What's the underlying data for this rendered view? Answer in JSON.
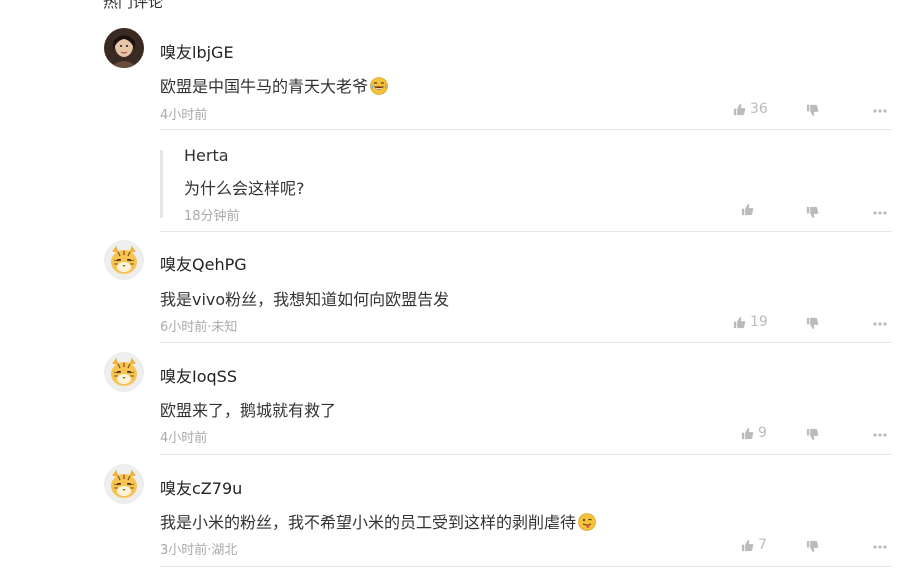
{
  "top_cut_text": "热门评论",
  "thread": {
    "comments": [
      {
        "username": "嗅友lbjGE",
        "content": "欧盟是中国牛马的青天大老爷",
        "emoji_icon": "laughing-emoji-icon",
        "meta": "4小时前",
        "likes": "36",
        "avatar": "photo",
        "reply": {
          "username": "Herta",
          "content": "为什么会这样呢?",
          "meta": "18分钟前"
        }
      },
      {
        "username": "嗅友QehPG",
        "content": "我是vivo粉丝，我想知道如何向欧盟告发",
        "meta": "6小时前·未知",
        "likes": "19",
        "avatar": "tiger"
      },
      {
        "username": "嗅友IoqSS",
        "content": "欧盟来了，鹅城就有救了",
        "meta": "4小时前",
        "likes": "9",
        "avatar": "tiger"
      },
      {
        "username": "嗅友cZ79u",
        "content": "我是小米的粉丝，我不希望小米的员工受到这样的剥削虐待",
        "emoji_icon": "tongue-out-emoji-icon",
        "meta": "3小时前·湖北",
        "likes": "7",
        "avatar": "tiger"
      }
    ]
  },
  "colors": {
    "text": "#222222",
    "meta": "#aaaaaa",
    "icon": "#bbbbbb",
    "divider": "#e6e6e6"
  }
}
